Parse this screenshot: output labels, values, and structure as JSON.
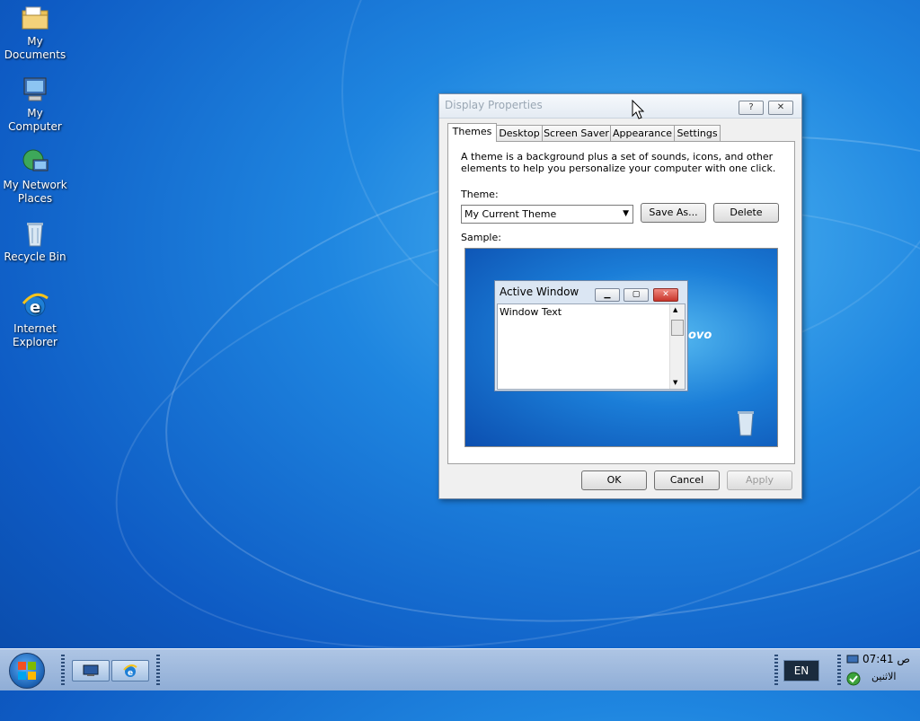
{
  "desktop": {
    "icons": [
      {
        "label": "My Documents"
      },
      {
        "label": "My Computer"
      },
      {
        "label": "My Network Places"
      },
      {
        "label": "Recycle Bin"
      },
      {
        "label": "Internet Explorer"
      }
    ]
  },
  "dialog": {
    "title": "Display Properties",
    "help_glyph": "?",
    "close_glyph": "✕",
    "tabs": [
      {
        "label": "Themes"
      },
      {
        "label": "Desktop"
      },
      {
        "label": "Screen Saver"
      },
      {
        "label": "Appearance"
      },
      {
        "label": "Settings"
      }
    ],
    "description": "A theme is a background plus a set of sounds, icons, and other elements to help you personalize your computer with one click.",
    "theme_label": "Theme:",
    "theme_value": "My Current Theme",
    "save_as_label": "Save As...",
    "delete_label": "Delete",
    "sample_label": "Sample:",
    "sample": {
      "brand_text": "ovo",
      "window_title": "Active Window",
      "window_text": "Window Text"
    },
    "ok_label": "OK",
    "cancel_label": "Cancel",
    "apply_label": "Apply"
  },
  "taskbar": {
    "language": "EN",
    "clock_time": "07:41 ص",
    "clock_day": "الاثنين"
  },
  "colors": {
    "desktop_blue": "#1f86e0",
    "dialog_bg": "#f0f0f0",
    "taskbar": "#aec5e4",
    "close_red": "#d9433a"
  }
}
